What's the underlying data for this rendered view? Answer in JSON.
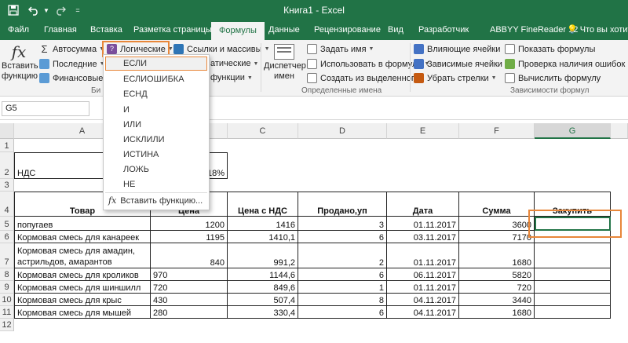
{
  "window": {
    "title": "Книга1  -  Excel"
  },
  "tabs": [
    "Файл",
    "Главная",
    "Вставка",
    "Разметка страницы",
    "Формулы",
    "Данные",
    "Рецензирование",
    "Вид",
    "Разработчик",
    "ABBYY FineReader 12"
  ],
  "active_tab": "Формулы",
  "tell_me": "Что вы хотите с",
  "ribbon": {
    "insert_function": [
      "Вставить",
      "функцию"
    ],
    "autosum": "Автосумма",
    "recent": "Последние",
    "financial": "Финансовые",
    "logical": "Логические",
    "lookup": "Ссылки и массивы",
    "math_partial": "атические",
    "more_partial": "функции",
    "library_partial": "Би",
    "name_manager": [
      "Диспетчер",
      "имен"
    ],
    "define_name": "Задать имя",
    "use_in_formula": "Использовать в формуле",
    "create_from_selection": "Создать из выделенного",
    "defined_names_group": "Определенные имена",
    "trace_precedents": "Влияющие ячейки",
    "trace_dependents": "Зависимые ячейки",
    "remove_arrows": "Убрать стрелки",
    "show_formulas": "Показать формулы",
    "error_checking": "Проверка наличия ошибок",
    "evaluate_formula": "Вычислить формулу",
    "formula_auditing_group": "Зависимости формул"
  },
  "dropdown": {
    "items": [
      "ЕСЛИ",
      "ЕСЛИОШИБКА",
      "ЕСНД",
      "И",
      "ИЛИ",
      "ИСКЛИЛИ",
      "ИСТИНА",
      "ЛОЖЬ",
      "НЕ"
    ],
    "highlighted": "ЕСЛИ",
    "insert_function": "Вставить функцию..."
  },
  "name_box": "G5",
  "columns": [
    "A",
    "B",
    "C",
    "D",
    "E",
    "F",
    "G"
  ],
  "selected_column": "G",
  "rows": [
    "1",
    "2",
    "3",
    "4",
    "5",
    "6",
    "7",
    "8",
    "9",
    "10",
    "11",
    "12"
  ],
  "sheet": {
    "vat_label": "НДС",
    "vat_value": "18%",
    "headers": [
      "Товар",
      "Цена",
      "Цена с НДС",
      "Продано,уп",
      "Дата",
      "Сумма",
      "Закупить"
    ],
    "data": [
      [
        "попугаев",
        "1200",
        "1416",
        "3",
        "01.11.2017",
        "3600"
      ],
      [
        "Кормовая смесь для канареек",
        "1195",
        "1410,1",
        "6",
        "03.11.2017",
        "7170"
      ],
      [
        "Кормовая смесь для амадин, астрильдов, амарантов",
        "840",
        "991,2",
        "2",
        "01.11.2017",
        "1680"
      ],
      [
        "Кормовая смесь для кроликов",
        "970",
        "1144,6",
        "6",
        "06.11.2017",
        "5820"
      ],
      [
        "Кормовая смесь для шиншилл",
        "720",
        "849,6",
        "1",
        "01.11.2017",
        "720"
      ],
      [
        "Кормовая смесь для крыс",
        "430",
        "507,4",
        "8",
        "04.11.2017",
        "3440"
      ],
      [
        "Кормовая смесь для мышей",
        "280",
        "330,4",
        "6",
        "04.11.2017",
        "1680"
      ]
    ]
  },
  "colors": {
    "excel_green": "#217346",
    "highlight_orange": "#e8873a"
  }
}
